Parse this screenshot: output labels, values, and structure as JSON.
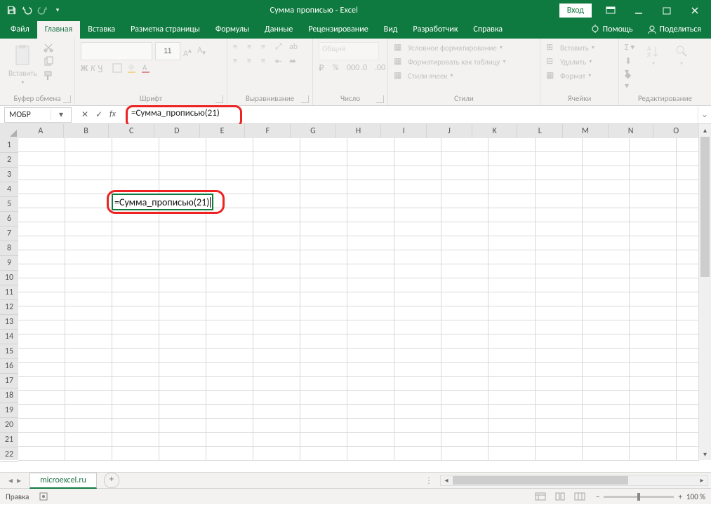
{
  "title": "Сумма прописью  -  Excel",
  "login": "Вход",
  "tabs": {
    "items": [
      "Файл",
      "Главная",
      "Вставка",
      "Разметка страницы",
      "Формулы",
      "Данные",
      "Рецензирование",
      "Вид",
      "Разработчик",
      "Справка"
    ],
    "active": 1,
    "help_hint": "Помощь",
    "share": "Поделиться"
  },
  "ribbon": {
    "clipboard": {
      "label": "Буфер обмена",
      "paste": "Вставить"
    },
    "font": {
      "label": "Шрифт",
      "name": "",
      "size": "11",
      "buttons": [
        "Ж",
        "К",
        "Ч"
      ]
    },
    "alignment": {
      "label": "Выравнивание"
    },
    "number": {
      "label": "Число",
      "format": "Общий"
    },
    "styles": {
      "label": "Стили",
      "cond": "Условное форматирование",
      "table": "Форматировать как таблицу",
      "cell": "Стили ячеек"
    },
    "cells": {
      "label": "Ячейки",
      "insert": "Вставить",
      "delete": "Удалить",
      "format": "Формат"
    },
    "editing": {
      "label": "Редактирование"
    }
  },
  "formula_bar": {
    "name_box": "МОБР",
    "value": "=Сумма_прописью(21)"
  },
  "grid": {
    "columns": [
      "A",
      "B",
      "C",
      "D",
      "E",
      "F",
      "G",
      "H",
      "I",
      "J",
      "K",
      "L",
      "M",
      "N",
      "O"
    ],
    "rows": 22,
    "active_cell": {
      "col": 2,
      "row": 5,
      "text": "=Сумма_прописью(21)"
    }
  },
  "sheet_tabs": {
    "active": "microexcel.ru"
  },
  "status": {
    "mode": "Правка",
    "zoom": "100 %"
  }
}
